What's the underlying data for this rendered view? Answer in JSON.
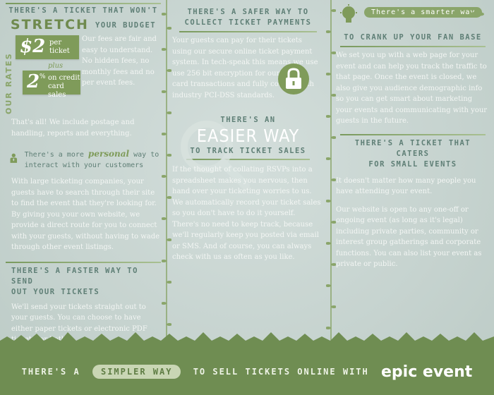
{
  "col1": {
    "top_heading": "There's a ticket that won't",
    "stretch": "STRETCH",
    "your_budget": "your budget",
    "price_per_ticket": "$2",
    "per_ticket_label": "per ticket",
    "plus": "plus",
    "percent": "2",
    "percent_sign": "%",
    "on_credit_label": "on credit card sales",
    "our_rates": "OUR RATES",
    "fees_text": "Our fees are fair and easy to understand. No hidden fees, no monthly fees and no per event fees.",
    "postage_text": "That's all! We include postage and handling, reports and everything.",
    "personal_intro_1": "There's a more",
    "personal_word": "personal",
    "personal_intro_2": "way to interact with your customers",
    "personal_body": "With large ticketing companies, your guests have to search through their site to find the event that they're looking for. By giving you your own website, we provide a direct route for you to connect with your guests, without having to wade through other event listings.",
    "faster_heading_1": "There's a faster way to send",
    "faster_heading_2": "out your tickets",
    "faster_body": "We'll send your tickets straight out to your guests. You can choose to have either paper tickets or electronic PDF tickets, or both."
  },
  "col2": {
    "safer_heading_1": "There's a safer way to",
    "safer_heading_2": "collect ticket payments",
    "safer_body": "Your guests can pay for their tickets using our secure online ticket payment system. In tech-speak this means we use use 256 bit encryption for our credit card transactions and fully comply with industry PCI-DSS standards.",
    "easier_pre": "There's an",
    "easier_big": "EASIER WAY",
    "easier_post": "to track ticket sales",
    "easier_body": "If the thought of collating RSVPs into a spreadsheet makes you nervous, then hand over your ticketing worries to us. We automatically record your ticket sales so you don't have to do it yourself. There's no need to keep track, because we'll regularly keep you posted via email or SMS. And of course, you can always check with us as often as you like."
  },
  "col3": {
    "smarter_pill": "There's a smarter way",
    "smarter_heading": "to crank up your fan base",
    "smarter_body": "We set you up with a web page for your event and can help you track the traffic to that page. Once the event is closed, we also give you audience demographic info so you can get smart about marketing your events and communicating with your guests in the future.",
    "small_heading_1": "There's a ticket that caters",
    "small_heading_2": "for small events",
    "small_body_1": "It doesn't matter how many people you have attending your event.",
    "small_body_2": "Our website is open to any one-off or ongoing event (as long as it's legal) including private parties, community or interest group gatherings and corporate functions. You can also list your event as private or public."
  },
  "footer": {
    "pre": "THERE'S A",
    "pill": "SIMPLER WAY",
    "post": "TO SELL TICKETS ONLINE WITH",
    "brand": "epic event"
  },
  "colors": {
    "accent_green": "#7f9b5a",
    "heading_teal": "#5f7f76",
    "background": "#c9d6d2",
    "footer_green": "#6f8d52"
  },
  "icons": [
    "person-icon",
    "padlock-icon",
    "lightbulb-icon",
    "magnifier-watermark-icon",
    "vine-ornament-icon"
  ]
}
